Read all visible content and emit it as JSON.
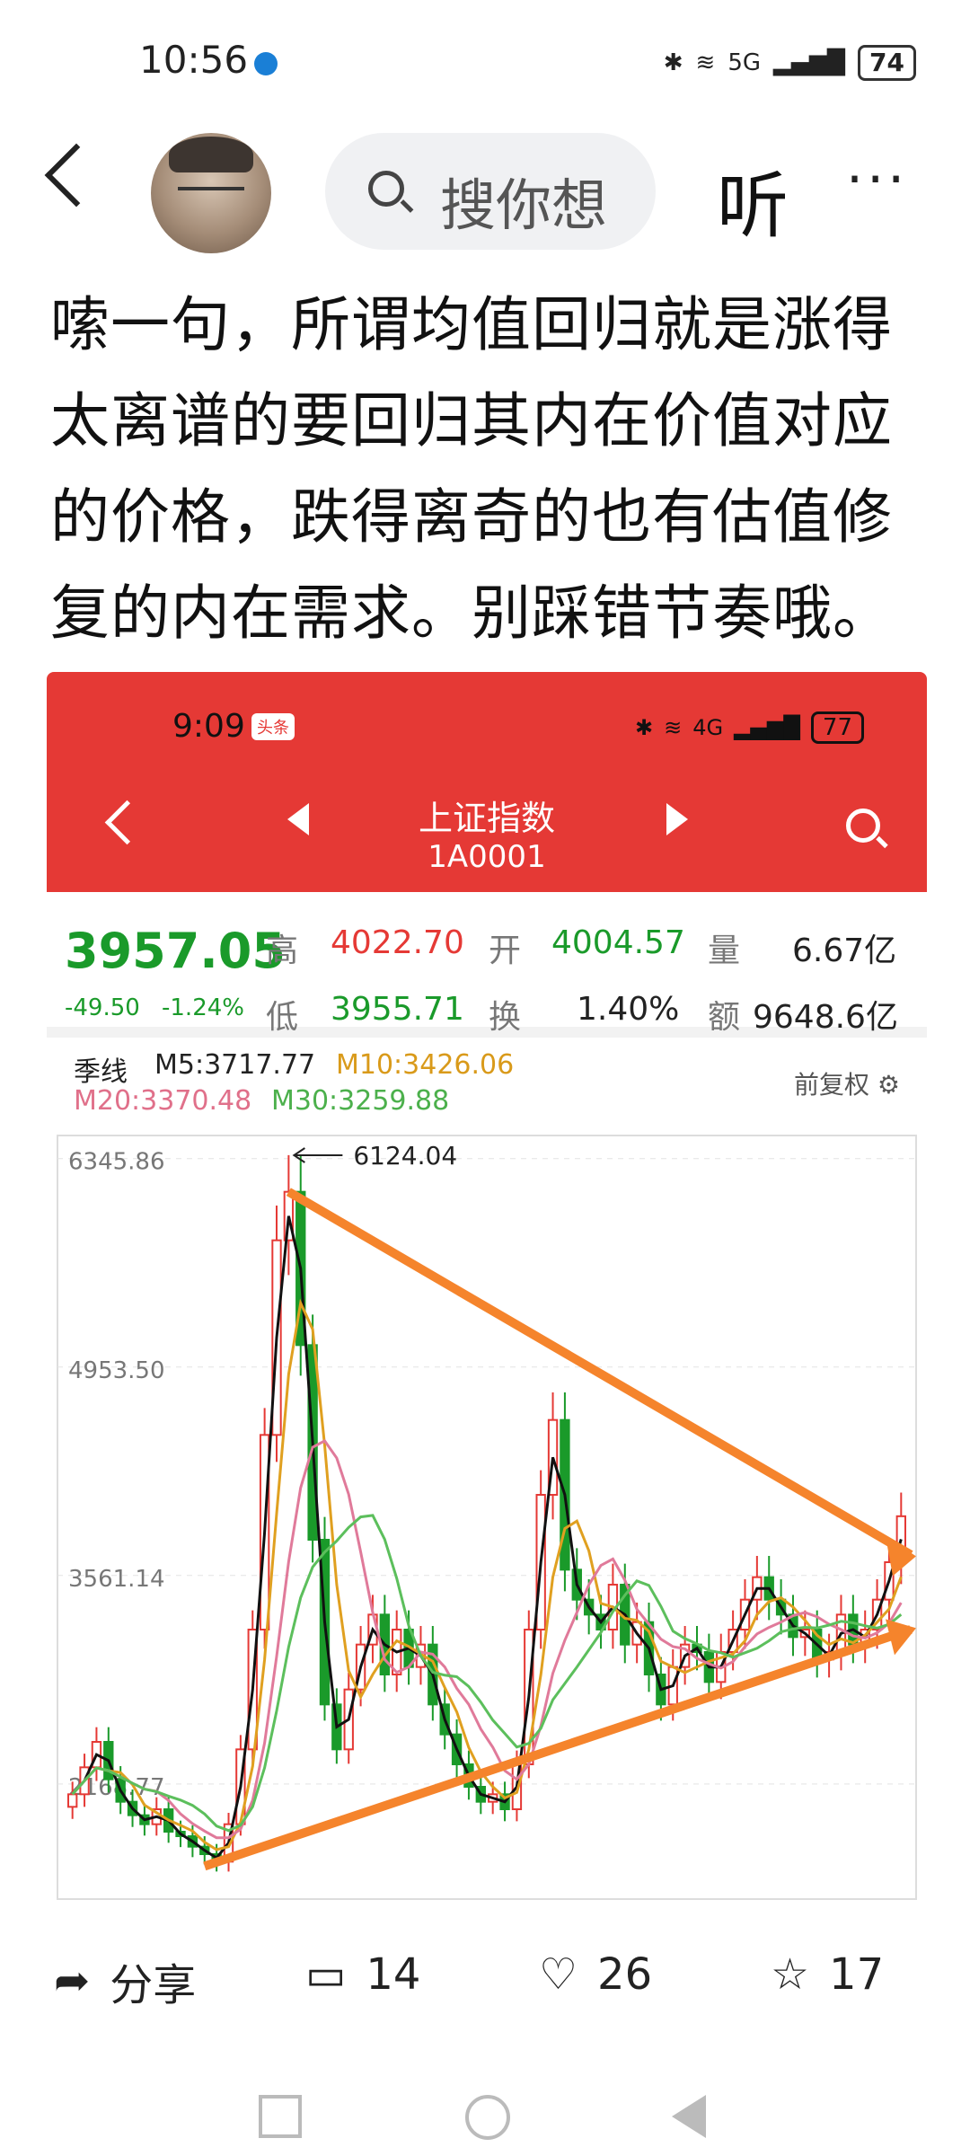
{
  "status_bar": {
    "time": "10:56",
    "battery": "74",
    "network": "5G"
  },
  "top_bar": {
    "search_placeholder": "搜你想",
    "listen_label": "听",
    "more_label": "···"
  },
  "post": {
    "text": "嗦一句，所谓均值回归就是涨得太离谱的要回归其内在价值对应的价格，跌得离奇的也有估值修复的内在需求。别踩错节奏哦。"
  },
  "screenshot": {
    "status": {
      "time": "9:09",
      "badge": "头条",
      "battery": "77",
      "network": "4G"
    },
    "title": "上证指数",
    "code": "1A0001",
    "quote": {
      "price": "3957.05",
      "change": "-49.50",
      "change_pct": "-1.24%",
      "high_label": "高",
      "high": "4022.70",
      "open_label": "开",
      "open": "4004.57",
      "volume_label": "量",
      "volume": "6.67亿",
      "low_label": "低",
      "low": "3955.71",
      "turnover_label": "换",
      "turnover": "1.40%",
      "amount_label": "额",
      "amount": "9648.6亿"
    },
    "chart_header": {
      "period": "季线",
      "ma5": "M5:3717.77",
      "ma10": "M10:3426.06",
      "ma20": "M20:3370.48",
      "ma30": "M30:3259.88",
      "rights": "前复权"
    },
    "annotation": "6124.04"
  },
  "chart_data": {
    "type": "candlestick",
    "title": "",
    "period": "季线",
    "y_ticks": [
      6345.86,
      4953.5,
      3561.14,
      2168.77
    ],
    "ylim": [
      1400,
      6500
    ],
    "max_label": 6124.04,
    "closes": [
      2100,
      2280,
      2450,
      2200,
      2050,
      1960,
      1900,
      2000,
      1850,
      1820,
      1750,
      1700,
      1650,
      1900,
      2400,
      3200,
      4500,
      5800,
      6124,
      5100,
      3800,
      2700,
      2400,
      2800,
      3100,
      3300,
      2900,
      3200,
      2950,
      3100,
      2700,
      2500,
      2300,
      2150,
      2050,
      2100,
      2000,
      2300,
      3200,
      4100,
      4600,
      3600,
      3400,
      3300,
      3200,
      3500,
      3100,
      3250,
      2900,
      2700,
      2950,
      3100,
      3050,
      2850,
      3050,
      3200,
      3400,
      3550,
      3400,
      3300,
      3150,
      3200,
      3000,
      3050,
      3300,
      3100,
      3200,
      3400,
      3650,
      3957
    ],
    "ma_series": [
      {
        "name": "M5",
        "color": "#111111"
      },
      {
        "name": "M10",
        "color": "#e0a020"
      },
      {
        "name": "M20",
        "color": "#e07a9a"
      },
      {
        "name": "M30",
        "color": "#5cbf5c"
      }
    ],
    "trendlines": "converging triangle (orange arrows)",
    "colors": {
      "up": "#e53935",
      "down": "#1a9a2a",
      "trend": "#f5842c"
    }
  },
  "actions": {
    "share_label": "分享",
    "comments": "14",
    "likes": "26",
    "favorites": "17"
  }
}
